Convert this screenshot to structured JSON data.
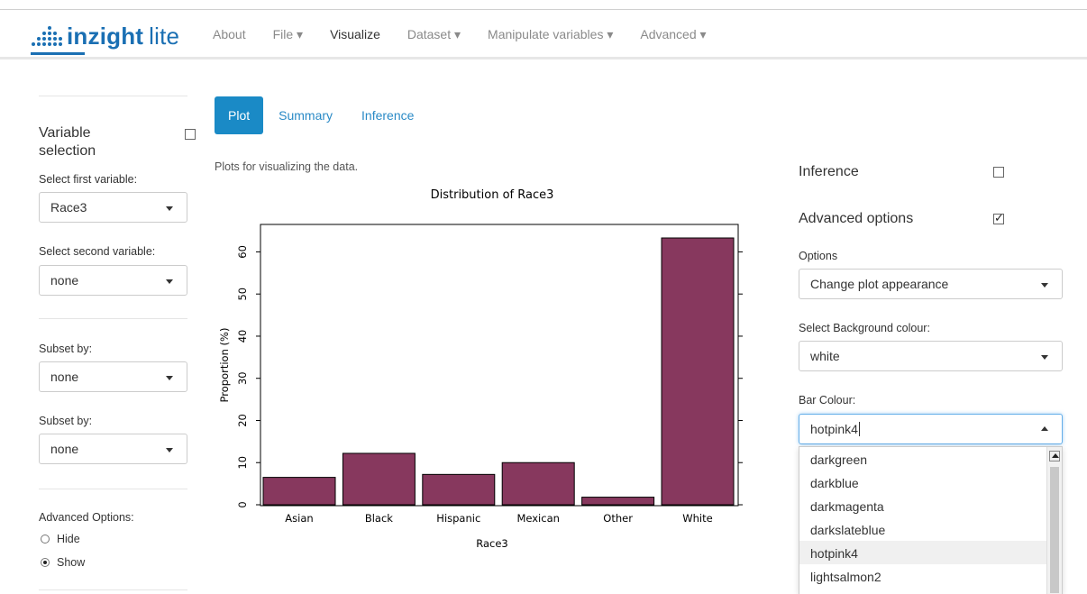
{
  "app": {
    "logo_main": "inzight",
    "logo_sub": "lite"
  },
  "nav": {
    "items": [
      {
        "label": "About",
        "active": false
      },
      {
        "label": "File ▾",
        "active": false
      },
      {
        "label": "Visualize",
        "active": true
      },
      {
        "label": "Dataset ▾",
        "active": false
      },
      {
        "label": "Manipulate variables ▾",
        "active": false
      },
      {
        "label": "Advanced ▾",
        "active": false
      }
    ]
  },
  "sidebar": {
    "title": "Variable selection",
    "first_label": "Select first variable:",
    "first_value": "Race3",
    "second_label": "Select second variable:",
    "second_value": "none",
    "subset1_label": "Subset by:",
    "subset1_value": "none",
    "subset2_label": "Subset by:",
    "subset2_value": "none",
    "adv_label": "Advanced Options:",
    "adv_options": [
      "Hide",
      "Show"
    ],
    "adv_selected": "Show"
  },
  "tabs": {
    "items": [
      "Plot",
      "Summary",
      "Inference"
    ],
    "active": "Plot",
    "description": "Plots for visualizing the data."
  },
  "right_panel": {
    "inference_label": "Inference",
    "inference_checked": false,
    "advanced_label": "Advanced options",
    "advanced_checked": true,
    "options_label": "Options",
    "options_value": "Change plot appearance",
    "bg_label": "Select Background colour:",
    "bg_value": "white",
    "bar_label": "Bar Colour:",
    "bar_value": "hotpink4",
    "bar_options": [
      "darkgreen",
      "darkblue",
      "darkmagenta",
      "darkslateblue",
      "hotpink4",
      "lightsalmon2"
    ],
    "bar_selected": "hotpink4"
  },
  "colors": {
    "bar": "#87385e",
    "accent": "#1a8ac6"
  },
  "chart_data": {
    "type": "bar",
    "title": "Distribution of Race3",
    "xlabel": "Race3",
    "ylabel": "Proportion (%)",
    "categories": [
      "Asian",
      "Black",
      "Hispanic",
      "Mexican",
      "Other",
      "White"
    ],
    "values": [
      6.5,
      12.2,
      7.2,
      10.0,
      1.8,
      63.3
    ],
    "ylim": [
      0,
      63.3
    ],
    "yticks": [
      0,
      10,
      20,
      30,
      40,
      50,
      60
    ],
    "grid": false
  }
}
